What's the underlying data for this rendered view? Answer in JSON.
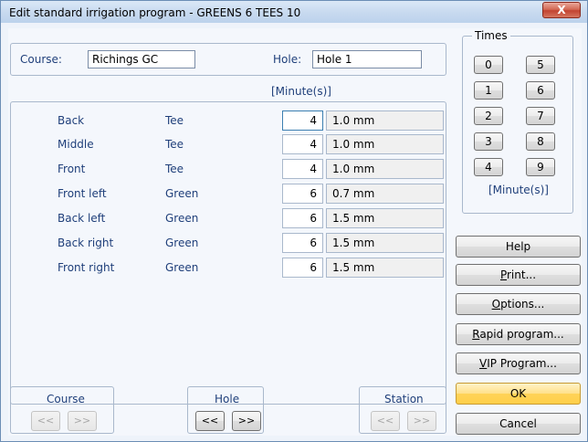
{
  "window": {
    "title": "Edit standard irrigation program - GREENS 6 TEES 10",
    "close_glyph": "X"
  },
  "header": {
    "course_label": "Course:",
    "course_value": "Richings GC",
    "hole_label": "Hole:",
    "hole_value": "Hole 1",
    "column_unit": "[Minute(s)]"
  },
  "rows": [
    {
      "position": "Back",
      "area": "Tee",
      "minutes": "4",
      "depth": "1.0 mm"
    },
    {
      "position": "Middle",
      "area": "Tee",
      "minutes": "4",
      "depth": "1.0 mm"
    },
    {
      "position": "Front",
      "area": "Tee",
      "minutes": "4",
      "depth": "1.0 mm"
    },
    {
      "position": "Front left",
      "area": "Green",
      "minutes": "6",
      "depth": "0.7 mm"
    },
    {
      "position": "Back left",
      "area": "Green",
      "minutes": "6",
      "depth": "1.5 mm"
    },
    {
      "position": "Back right",
      "area": "Green",
      "minutes": "6",
      "depth": "1.5 mm"
    },
    {
      "position": "Front right",
      "area": "Green",
      "minutes": "6",
      "depth": "1.5 mm"
    }
  ],
  "times": {
    "title": "Times",
    "buttons": [
      "0",
      "5",
      "1",
      "6",
      "2",
      "7",
      "3",
      "8",
      "4",
      "9"
    ],
    "unit": "[Minute(s)]"
  },
  "actions": {
    "help": "Help",
    "print": {
      "ul": "P",
      "rest": "rint..."
    },
    "options": {
      "ul": "O",
      "rest": "ptions..."
    },
    "rapid": {
      "ul": "R",
      "rest": "apid program..."
    },
    "vip": {
      "ul": "V",
      "rest": "IP Program..."
    },
    "ok": "OK",
    "cancel": "Cancel"
  },
  "nav": {
    "course": {
      "title": "Course",
      "prev": "<<",
      "next": ">>",
      "enabled": false
    },
    "hole": {
      "title": "Hole",
      "prev": "<<",
      "next": ">>",
      "enabled": true
    },
    "station": {
      "title": "Station",
      "prev": "<<",
      "next": ">>",
      "enabled": false
    }
  },
  "colors": {
    "label_blue": "#1f3f7a",
    "ok_yellow": "#ffd358",
    "title_bar": "#c7d9ef"
  }
}
